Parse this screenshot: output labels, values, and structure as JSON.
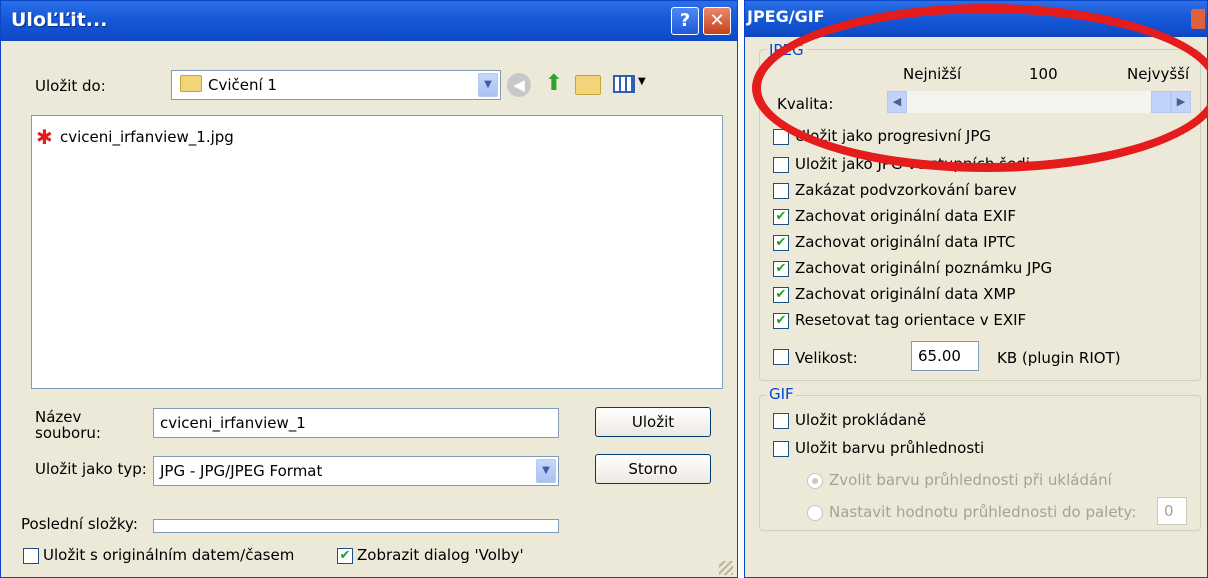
{
  "save_dialog": {
    "title": "UloĽĽit...",
    "help_label": "?",
    "close_label": "✕",
    "save_in_label": "Uložit do:",
    "save_in_value": "Cvičení 1",
    "toolbar_icons": [
      "back-icon",
      "up-folder-icon",
      "new-folder-icon",
      "view-menu-icon"
    ],
    "files": [
      {
        "name": "cviceni_irfanview_1.jpg",
        "icon": "irfanview-file-icon"
      }
    ],
    "filename_label": "Název souboru:",
    "filename_value": "cviceni_irfanview_1",
    "filetype_label": "Uložit jako typ:",
    "filetype_value": "JPG - JPG/JPEG Format",
    "save_button": "Uložit",
    "cancel_button": "Storno",
    "recent_label": "Poslední složky:",
    "recent_value": "",
    "keep_date_label": "Uložit s originálním datem/časem",
    "keep_date_checked": false,
    "show_options_label": "Zobrazit dialog 'Volby'",
    "show_options_checked": true
  },
  "jpeg_dialog": {
    "title": "JPEG/GIF",
    "jpeg_group_label": "JPEG",
    "quality_low": "Nejnižší",
    "quality_value": "100",
    "quality_high": "Nejvyšší",
    "quality_label": "Kvalita:",
    "quality_fraction": 1.0,
    "options": [
      {
        "label": "Uložit jako progresivní JPG",
        "checked": false
      },
      {
        "label": "Uložit jako JPG ve stupních šedi",
        "checked": false
      },
      {
        "label": "Zakázat podvzorkování barev",
        "checked": false
      },
      {
        "label": "Zachovat originální data EXIF",
        "checked": true
      },
      {
        "label": "Zachovat originální data IPTC",
        "checked": true
      },
      {
        "label": "Zachovat originální poznámku JPG",
        "checked": true
      },
      {
        "label": "Zachovat originální data XMP",
        "checked": true
      },
      {
        "label": "Resetovat tag orientace v EXIF",
        "checked": true
      }
    ],
    "size_label": "Velikost:",
    "size_checked": false,
    "size_value": "65.00",
    "size_unit": "KB (plugin RIOT)",
    "gif_group_label": "GIF",
    "gif_options": [
      {
        "label": "Uložit prokládaně",
        "checked": false
      },
      {
        "label": "Uložit barvu průhlednosti",
        "checked": false
      }
    ],
    "radio_pick_label": "Zvolit barvu průhlednosti při ukládání",
    "radio_palette_label": "Nastavit hodnotu průhlednosti do palety:",
    "palette_value": "0"
  },
  "colors": {
    "title_blue": "#1659d8",
    "annotation_red": "#e41c1c",
    "check_green": "#21a121",
    "group_blue": "#0046d5"
  }
}
